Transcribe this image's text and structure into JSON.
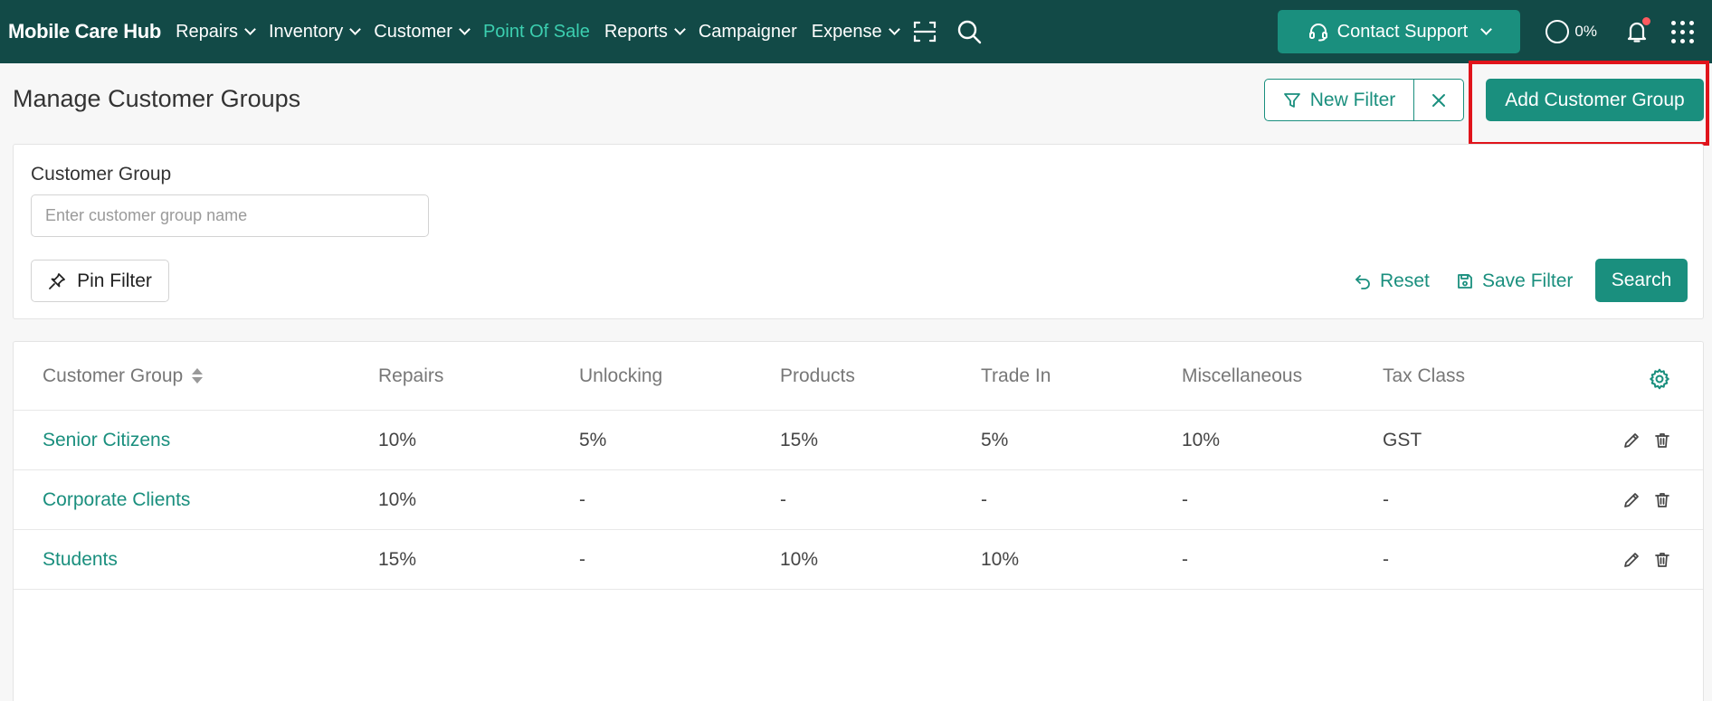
{
  "brand": "Mobile Care Hub",
  "nav": {
    "items": [
      {
        "label": "Repairs",
        "dropdown": true,
        "active": false
      },
      {
        "label": "Inventory",
        "dropdown": true,
        "active": false
      },
      {
        "label": "Customer",
        "dropdown": true,
        "active": false
      },
      {
        "label": "Point Of Sale",
        "dropdown": false,
        "active": true
      },
      {
        "label": "Reports",
        "dropdown": true,
        "active": false
      },
      {
        "label": "Campaigner",
        "dropdown": false,
        "active": false
      },
      {
        "label": "Expense",
        "dropdown": true,
        "active": false
      }
    ],
    "icons": [
      "scan-icon",
      "search-icon"
    ],
    "support_label": "Contact Support",
    "progress_label": "0%",
    "notification_dot": true
  },
  "colors": {
    "nav_bg": "#124a47",
    "accent": "#1a8f7e",
    "active_nav": "#3ccfb0",
    "highlight": "#e0141b"
  },
  "page": {
    "title": "Manage Customer Groups",
    "new_filter_label": "New Filter",
    "add_button_label": "Add Customer Group"
  },
  "filter": {
    "field_label": "Customer Group",
    "input_value": "",
    "input_placeholder": "Enter customer group name",
    "pin_label": "Pin Filter",
    "reset_label": "Reset",
    "save_label": "Save Filter",
    "search_label": "Search"
  },
  "table": {
    "columns": [
      "Customer Group",
      "Repairs",
      "Unlocking",
      "Products",
      "Trade In",
      "Miscellaneous",
      "Tax Class"
    ],
    "rows": [
      [
        "Senior Citizens",
        "10%",
        "5%",
        "15%",
        "5%",
        "10%",
        "GST"
      ],
      [
        "Corporate Clients",
        "10%",
        "-",
        "-",
        "-",
        "-",
        "-"
      ],
      [
        "Students",
        "15%",
        "-",
        "10%",
        "10%",
        "-",
        "-"
      ]
    ]
  }
}
